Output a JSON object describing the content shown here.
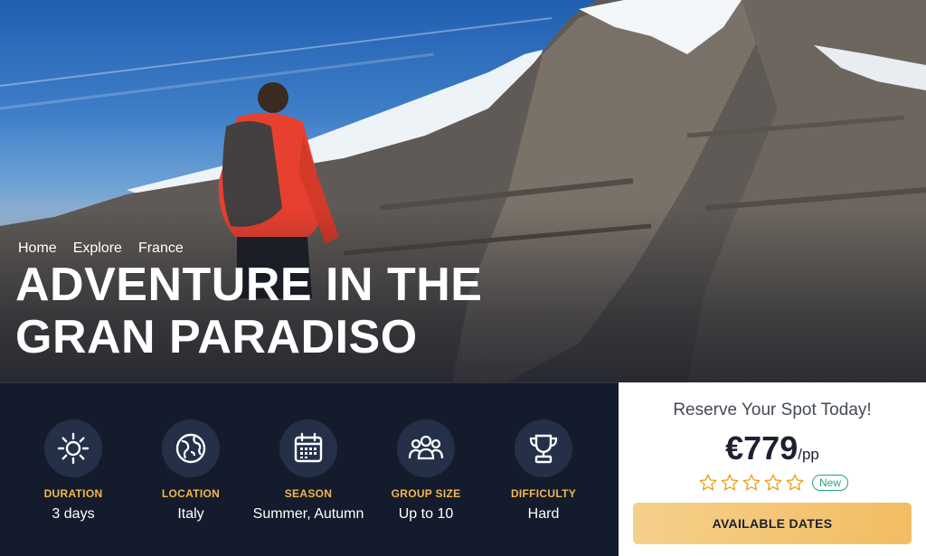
{
  "breadcrumb": [
    "Home",
    "Explore",
    "France"
  ],
  "hero": {
    "title": "ADVENTURE IN THE GRAN PARADISO"
  },
  "facts": [
    {
      "icon": "sun-icon",
      "label": "DURATION",
      "value": "3 days"
    },
    {
      "icon": "globe-icon",
      "label": "LOCATION",
      "value": "Italy"
    },
    {
      "icon": "calendar-icon",
      "label": "SEASON",
      "value": "Summer, Autumn"
    },
    {
      "icon": "group-icon",
      "label": "GROUP SIZE",
      "value": "Up to 10"
    },
    {
      "icon": "trophy-icon",
      "label": "DIFFICULTY",
      "value": "Hard"
    }
  ],
  "booking": {
    "heading": "Reserve Your Spot Today!",
    "price": "€779",
    "per": "/pp",
    "rating": 0,
    "rating_max": 5,
    "badge": "New",
    "cta_label": "AVAILABLE DATES"
  },
  "colors": {
    "accent": "#f0b84f",
    "dark_bg": "#141b2c",
    "icon_circle": "#243048",
    "cta": "#f2bd62",
    "badge": "#2aa37a"
  }
}
